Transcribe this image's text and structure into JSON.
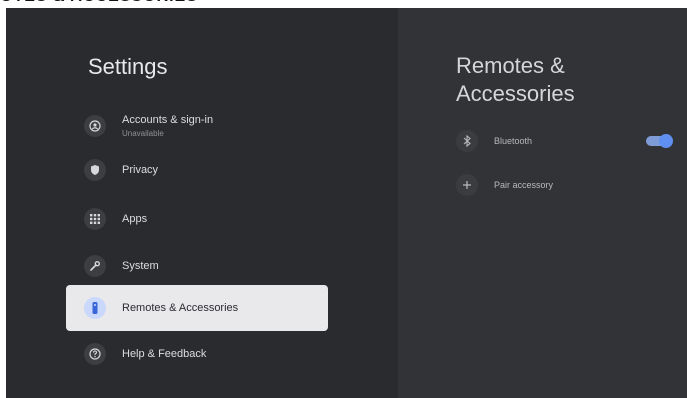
{
  "top_caption": "OTES & ACCESSORIES",
  "settings": {
    "title": "Settings",
    "items": [
      {
        "label": "Accounts & sign-in",
        "sub": "Unavailable",
        "icon": "account-icon"
      },
      {
        "label": "Privacy",
        "icon": "shield-icon"
      },
      {
        "label": "Apps",
        "icon": "apps-grid-icon"
      },
      {
        "label": "System",
        "icon": "wrench-icon"
      },
      {
        "label": "Remotes & Accessories",
        "icon": "remote-icon",
        "selected": true
      },
      {
        "label": "Help & Feedback",
        "icon": "help-icon"
      }
    ]
  },
  "panel": {
    "title": "Remotes & Accessories",
    "rows": [
      {
        "label": "Bluetooth",
        "icon": "bluetooth-icon",
        "toggle": true,
        "toggle_on": true
      },
      {
        "label": "Pair accessory",
        "icon": "plus-icon"
      }
    ]
  },
  "colors": {
    "left_bg": "#2a2b2e",
    "right_bg": "#323336",
    "selected_bg": "#e9e9ec",
    "accent": "#5f8ff0"
  }
}
